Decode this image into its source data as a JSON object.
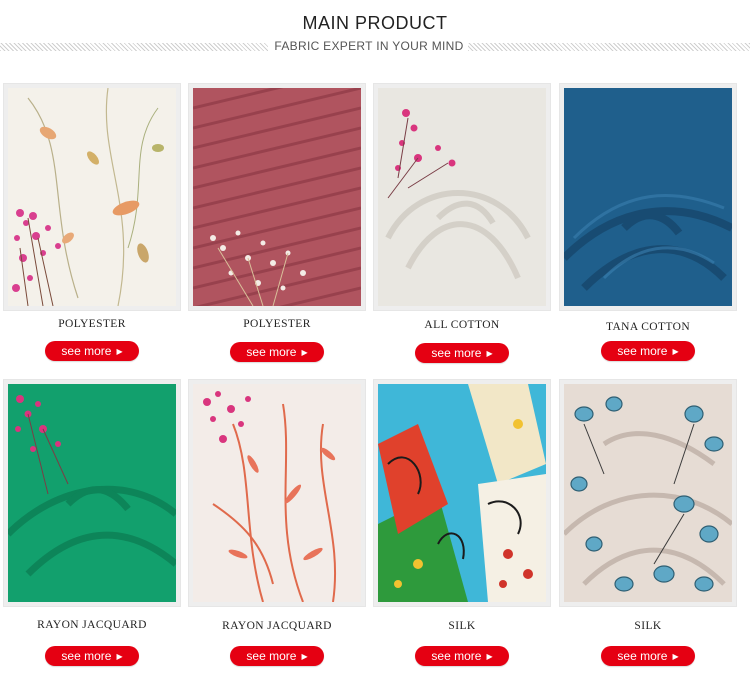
{
  "header": {
    "title": "MAIN PRODUCT",
    "subtitle": "FABRIC EXPERT IN YOUR MIND"
  },
  "products": [
    {
      "label": "POLYESTER",
      "button": "see more",
      "icon": "arrow-right-icon"
    },
    {
      "label": "POLYESTER",
      "button": "see more",
      "icon": "arrow-right-icon"
    },
    {
      "label": "ALL COTTON",
      "button": "see more",
      "icon": "arrow-right-icon"
    },
    {
      "label": "TANA COTTON",
      "button": "see more",
      "icon": "arrow-right-icon"
    },
    {
      "label": "RAYON JACQUARD",
      "button": "see more",
      "icon": "arrow-right-icon"
    },
    {
      "label": "RAYON JACQUARD",
      "button": "see more",
      "icon": "arrow-right-icon"
    },
    {
      "label": "SILK",
      "button": "see more",
      "icon": "arrow-right-icon"
    },
    {
      "label": "SILK",
      "button": "see more",
      "icon": "arrow-right-icon"
    }
  ],
  "colors": {
    "button": "#e50012",
    "title": "#222222"
  }
}
